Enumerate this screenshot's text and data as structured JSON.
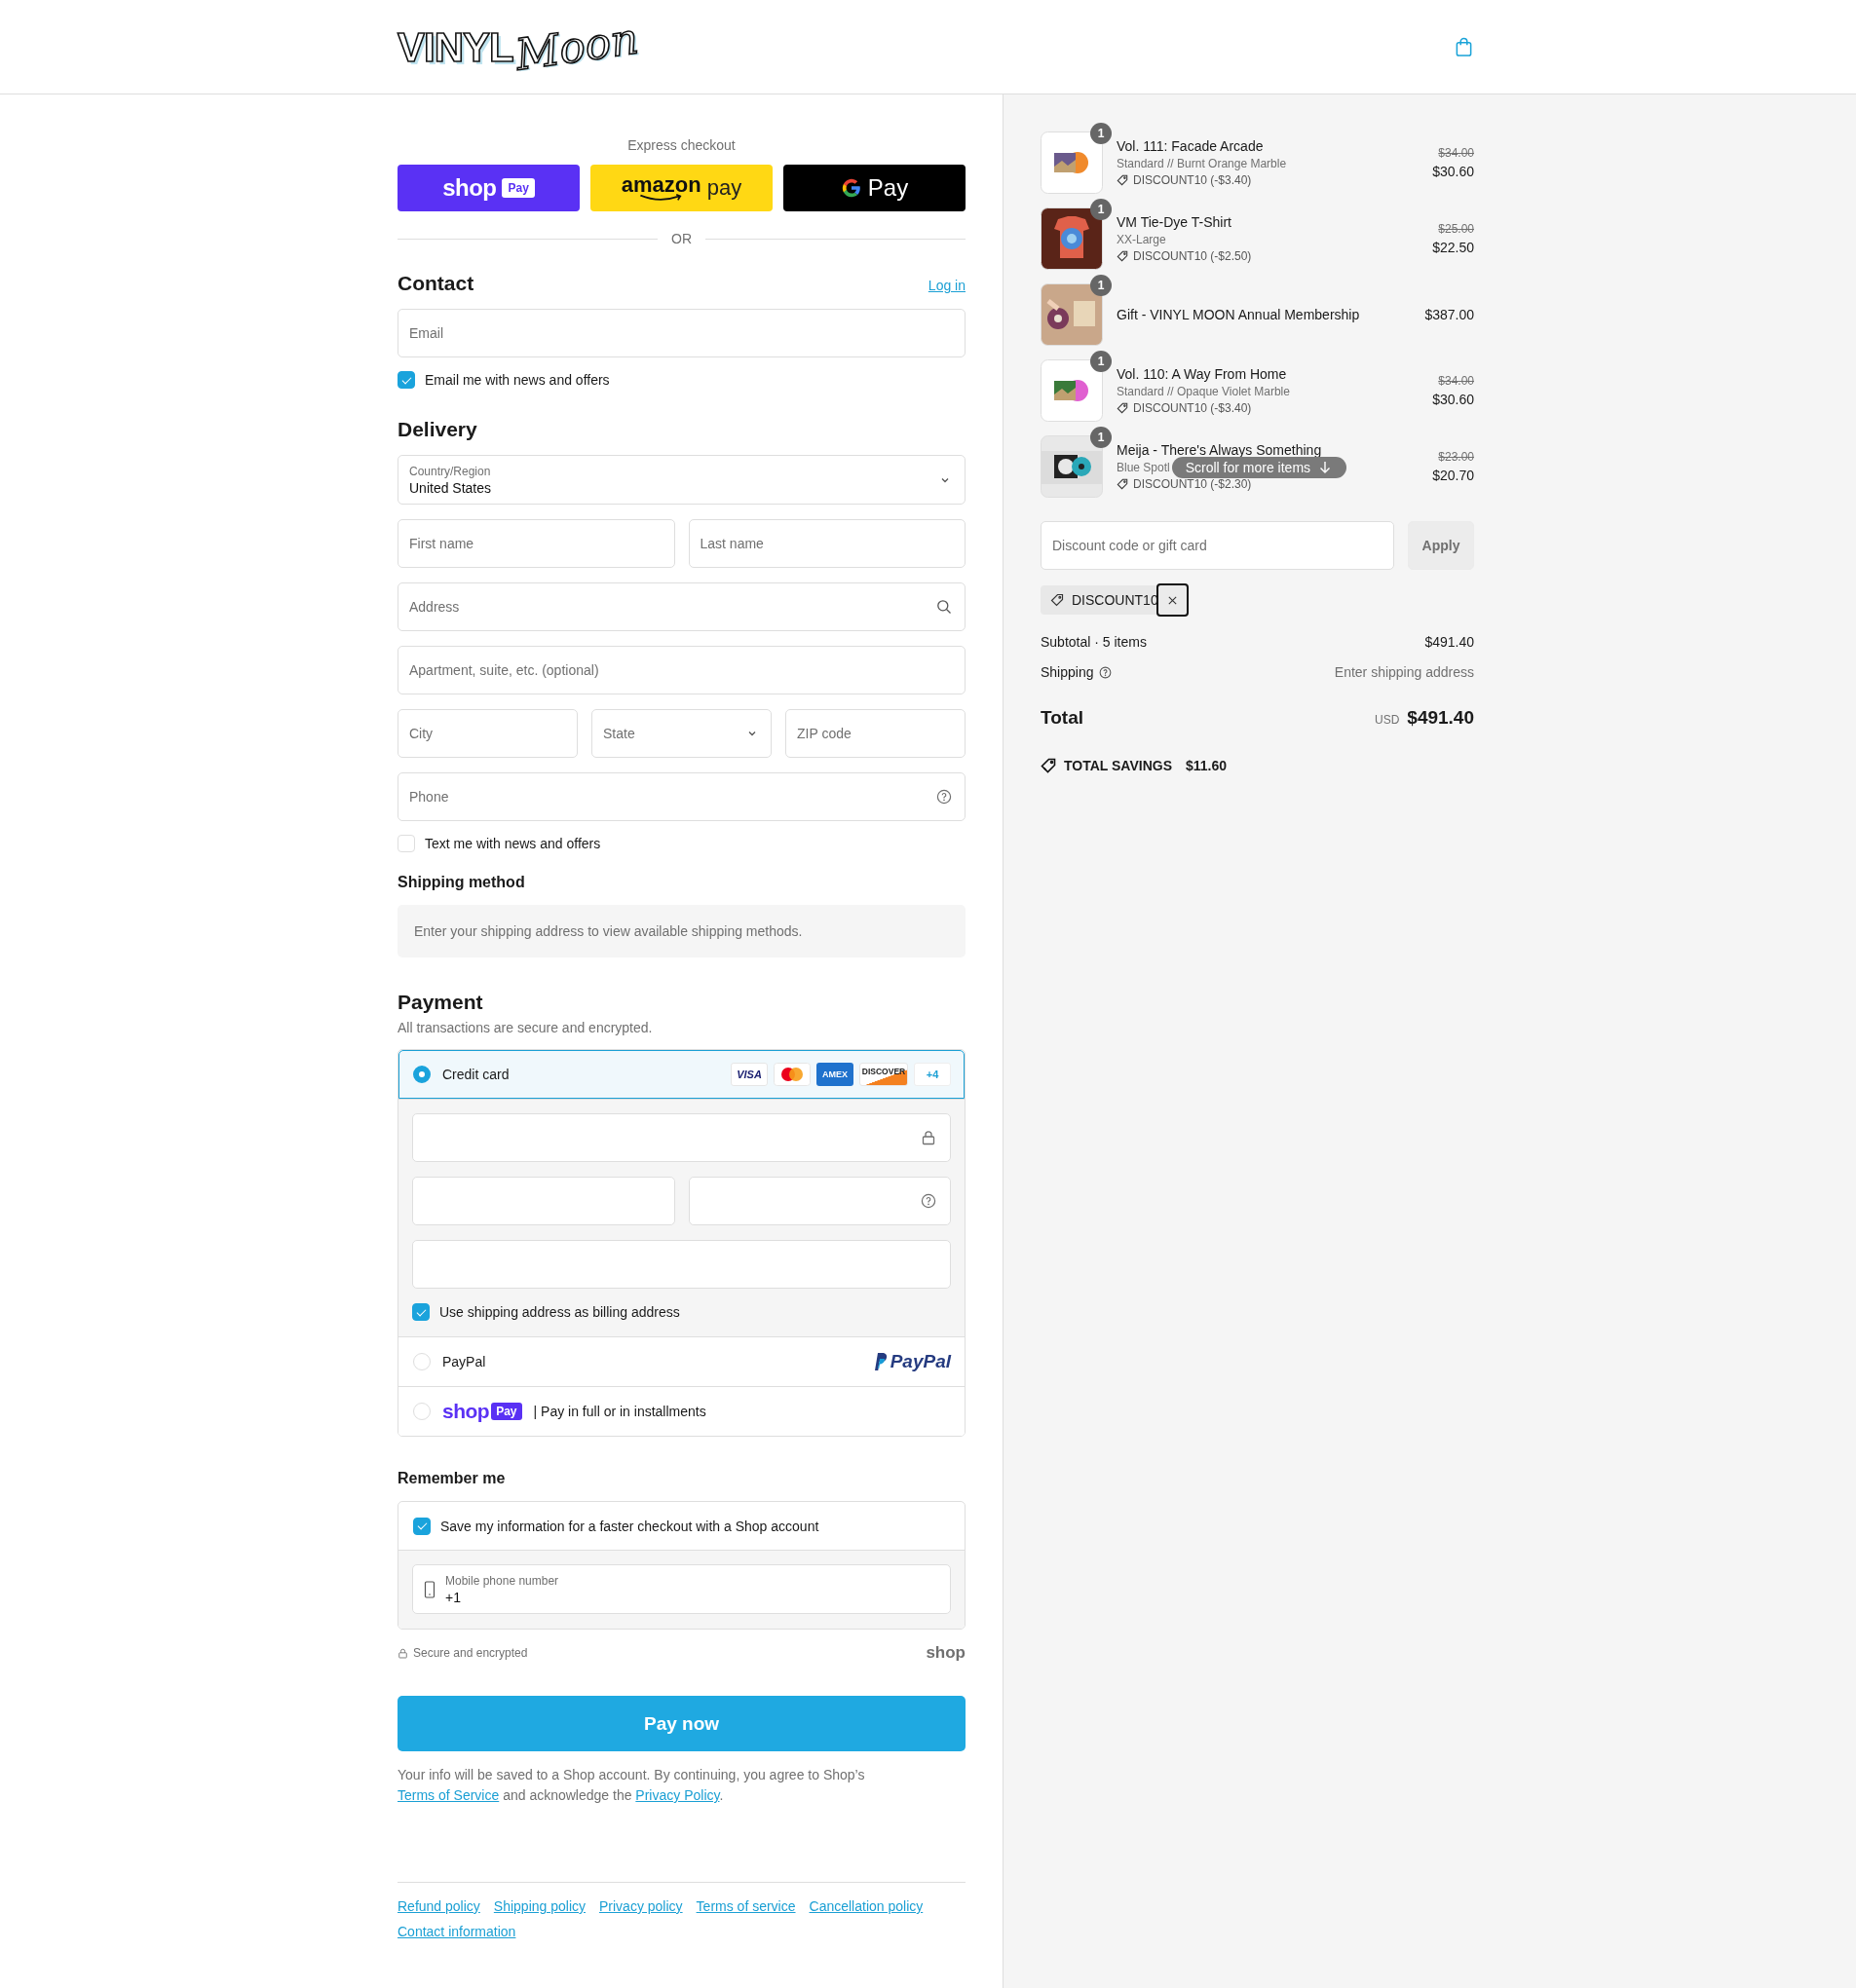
{
  "header": {
    "logo": {
      "word": "VINYL",
      "script": "Moon"
    }
  },
  "express": {
    "label": "Express checkout",
    "divider": "OR",
    "buttons": [
      {
        "kind": "shop",
        "text": "shop",
        "badge": "Pay"
      },
      {
        "kind": "amazon",
        "text": "amazon",
        "suffix": "pay"
      },
      {
        "kind": "gpay",
        "text": "Pay"
      }
    ]
  },
  "contact": {
    "title": "Contact",
    "login": "Log in",
    "email": {
      "placeholder": "Email"
    },
    "news": {
      "label": "Email me with news and offers",
      "checked": true
    }
  },
  "delivery": {
    "title": "Delivery",
    "country": {
      "label": "Country/Region",
      "value": "United States"
    },
    "field_rows": [
      [
        {
          "kind": "text",
          "placeholder": "First name"
        },
        {
          "kind": "text",
          "placeholder": "Last name"
        }
      ],
      [
        {
          "kind": "search",
          "placeholder": "Address"
        }
      ],
      [
        {
          "kind": "text",
          "placeholder": "Apartment, suite, etc. (optional)"
        }
      ],
      [
        {
          "kind": "text",
          "placeholder": "City"
        },
        {
          "kind": "select",
          "placeholder": "State"
        },
        {
          "kind": "text",
          "placeholder": "ZIP code"
        }
      ],
      [
        {
          "kind": "help",
          "placeholder": "Phone"
        }
      ]
    ],
    "text_news": {
      "label": "Text me with news and offers",
      "checked": false
    }
  },
  "shipping_method": {
    "title": "Shipping method",
    "note": "Enter your shipping address to view available shipping methods."
  },
  "payment": {
    "title": "Payment",
    "subtitle": "All transactions are secure and encrypted.",
    "methods": [
      {
        "kind": "card",
        "label": "Credit card",
        "selected": true,
        "brands": [
          {
            "kind": "visa",
            "text": "VISA"
          },
          {
            "kind": "mastercard"
          },
          {
            "kind": "amex",
            "text": "AMEX"
          },
          {
            "kind": "discover",
            "text": "DISCOVER"
          },
          {
            "kind": "more",
            "text": "+4"
          }
        ]
      },
      {
        "kind": "paypal",
        "label": "PayPal",
        "selected": false,
        "logo": "PayPal"
      },
      {
        "kind": "shoppay",
        "selected": false,
        "logo": "shop",
        "badge": "Pay",
        "label": "| Pay in full or in installments"
      }
    ],
    "billing": {
      "label": "Use shipping address as billing address",
      "checked": true
    }
  },
  "remember": {
    "title": "Remember me",
    "save": {
      "label": "Save my information for a faster checkout with a Shop account",
      "checked": true
    },
    "phone": {
      "label": "Mobile phone number",
      "value": "+1"
    },
    "secure": "Secure and encrypted",
    "brand": "shop"
  },
  "pay_button": "Pay now",
  "legal": [
    {
      "kind": "text",
      "text": "Your info will be saved to a Shop account. By continuing, you agree to Shop’s "
    },
    {
      "kind": "link",
      "text": "Terms of Service"
    },
    {
      "kind": "text",
      "text": " and acknowledge the "
    },
    {
      "kind": "link",
      "text": "Privacy Policy"
    },
    {
      "kind": "text",
      "text": "."
    }
  ],
  "footer_links": [
    "Refund policy",
    "Shipping policy",
    "Privacy policy",
    "Terms of service",
    "Cancellation policy",
    "Contact information"
  ],
  "summary": {
    "items": [
      {
        "quantity": "1",
        "name": "Vol. 111: Facade Arcade",
        "variant": "Standard // Burnt Orange Marble",
        "discount": "DISCOUNT10 (-$3.40)",
        "original_price": "$34.00",
        "price": "$30.60"
      },
      {
        "quantity": "1",
        "name": "VM Tie-Dye T-Shirt",
        "variant": "XX-Large",
        "discount": "DISCOUNT10 (-$2.50)",
        "original_price": "$25.00",
        "price": "$22.50"
      },
      {
        "quantity": "1",
        "name": "Gift - VINYL MOON Annual Membership",
        "price": "$387.00"
      },
      {
        "quantity": "1",
        "name": "Vol. 110: A Way From Home",
        "variant": "Standard // Opaque Violet Marble",
        "discount": "DISCOUNT10 (-$3.40)",
        "original_price": "$34.00",
        "price": "$30.60"
      },
      {
        "quantity": "1",
        "name": "Meija - There's Always Something",
        "variant": "Blue Spotl",
        "discount": "DISCOUNT10 (-$2.30)",
        "original_price": "$23.00",
        "price": "$20.70"
      }
    ],
    "scroll_hint": "Scroll for more items",
    "discount_field": {
      "placeholder": "Discount code or gift card"
    },
    "apply": {
      "label": "Apply",
      "disabled": true
    },
    "applied_code": "DISCOUNT10",
    "subtotal": {
      "label": "Subtotal · 5 items",
      "value": "$491.40"
    },
    "shipping": {
      "label": "Shipping",
      "value": "Enter shipping address"
    },
    "total": {
      "label": "Total",
      "currency": "USD",
      "value": "$491.40"
    },
    "savings": {
      "label": "TOTAL SAVINGS",
      "value": "$11.60"
    }
  }
}
